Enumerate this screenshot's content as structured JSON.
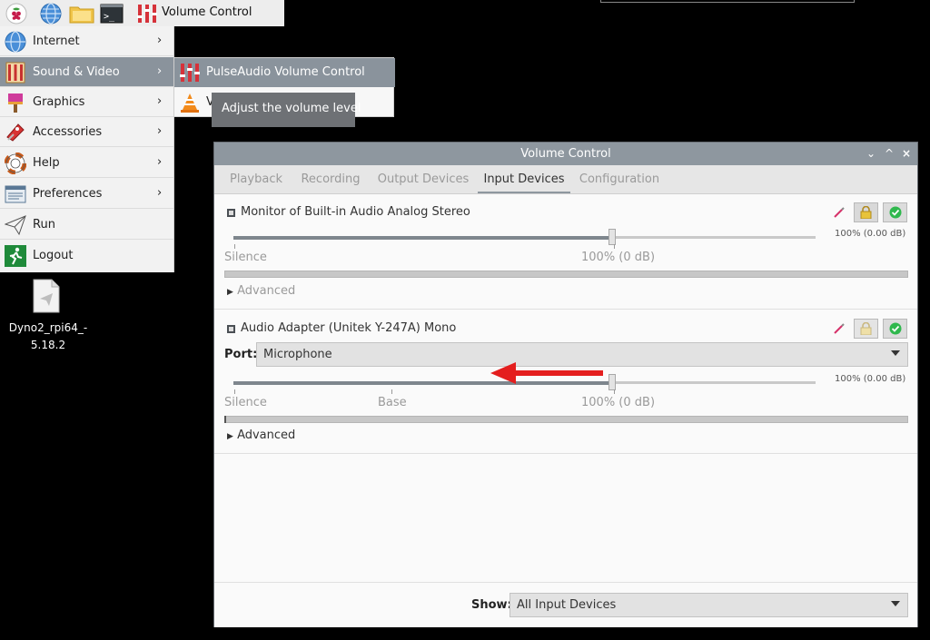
{
  "taskbar": {
    "active_window_label": "Volume Control",
    "icons": [
      "raspberry-icon",
      "web-browser-icon",
      "file-manager-icon",
      "terminal-icon",
      "volume-control-icon"
    ]
  },
  "menu": {
    "items": [
      {
        "label": "Internet",
        "icon": "globe-icon"
      },
      {
        "label": "Sound & Video",
        "icon": "sound-video-icon"
      },
      {
        "label": "Graphics",
        "icon": "paint-icon"
      },
      {
        "label": "Accessories",
        "icon": "accessories-icon"
      },
      {
        "label": "Help",
        "icon": "help-lifebuoy-icon"
      },
      {
        "label": "Preferences",
        "icon": "preferences-icon"
      },
      {
        "label": "Run",
        "icon": "run-paper-plane-icon"
      },
      {
        "label": "Logout",
        "icon": "logout-icon"
      }
    ],
    "arrow": "›"
  },
  "submenu": {
    "items": [
      {
        "label": "PulseAudio Volume Control",
        "icon": "mixer-icon"
      },
      {
        "label": "V",
        "icon": "vlc-icon"
      }
    ]
  },
  "tooltip": {
    "text": "Adjust the volume level"
  },
  "desktop": {
    "file_label_line1": "Dyno2_rpi64_-",
    "file_label_line2": "5.18.2"
  },
  "window": {
    "title": "Volume Control",
    "controls": {
      "minimize": "⌄",
      "maximize": "^",
      "close": "×"
    },
    "tabs": [
      "Playback",
      "Recording",
      "Output Devices",
      "Input Devices",
      "Configuration"
    ],
    "active_tab": "Input Devices",
    "devices": [
      {
        "name": "Monitor of Built-in Audio Analog Stereo",
        "volume_label": "100% (0.00 dB)",
        "volume_fraction": 0.65,
        "tick_silence": "Silence",
        "tick_100": "100% (0 dB)",
        "advanced": "Advanced"
      },
      {
        "name": "Audio Adapter (Unitek Y-247A) Mono",
        "port_label": "Port:",
        "port_value": "Microphone",
        "volume_label": "100% (0.00 dB)",
        "volume_fraction": 0.65,
        "tick_silence": "Silence",
        "tick_base": "Base",
        "tick_100": "100% (0 dB)",
        "advanced": "Advanced"
      }
    ],
    "show_label": "Show:",
    "show_value": "All Input Devices"
  },
  "colors": {
    "accent": "#8e979f",
    "red_arrow": "#e41e1e",
    "lock_yellow": "#e8c33a",
    "check_green": "#2fb84d"
  }
}
